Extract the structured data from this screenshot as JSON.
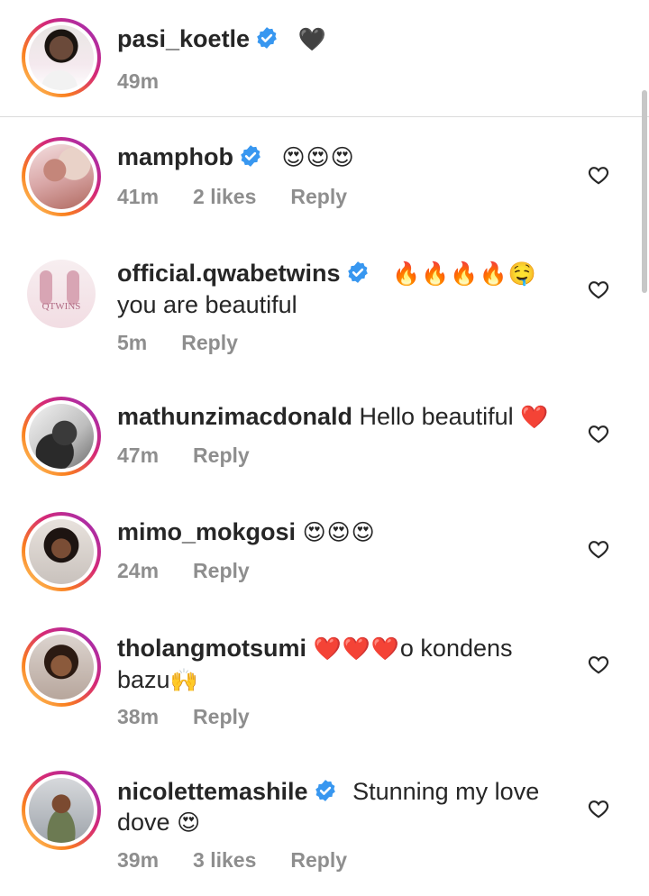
{
  "caption": {
    "username": "pasi_koetle",
    "emoji": "🖤",
    "time": "49m"
  },
  "comments": [
    {
      "username": "mamphob",
      "verified": true,
      "text": "",
      "emoji": "😍😍😍",
      "time": "41m",
      "likes": "2 likes",
      "reply": "Reply"
    },
    {
      "username": "official.qwabetwins",
      "verified": true,
      "emoji": "🔥🔥🔥🔥🤤",
      "text": "you are beautiful",
      "time": "5m",
      "reply": "Reply",
      "avatar_text": "QTWINS"
    },
    {
      "username": "mathunzimacdonald",
      "verified": false,
      "text": "Hello beautiful",
      "emoji": "❤️",
      "time": "47m",
      "reply": "Reply"
    },
    {
      "username": "mimo_mokgosi",
      "verified": false,
      "text": "",
      "emoji": "😍😍😍",
      "time": "24m",
      "reply": "Reply"
    },
    {
      "username": "tholangmotsumi",
      "verified": false,
      "emoji": "❤️❤️❤️",
      "text": "o kondens",
      "text2": "bazu",
      "emoji2": "🙌",
      "time": "38m",
      "reply": "Reply"
    },
    {
      "username": "nicolettemashile",
      "verified": true,
      "text": "Stunning my love",
      "text2": "dove",
      "emoji2": "😍",
      "time": "39m",
      "likes": "3 likes",
      "reply": "Reply"
    }
  ],
  "icons": {
    "verified": "verified-badge-icon",
    "like": "heart-outline-icon"
  },
  "colors": {
    "verified": "#3897f0",
    "meta": "#8e8e8e",
    "text": "#262626"
  }
}
